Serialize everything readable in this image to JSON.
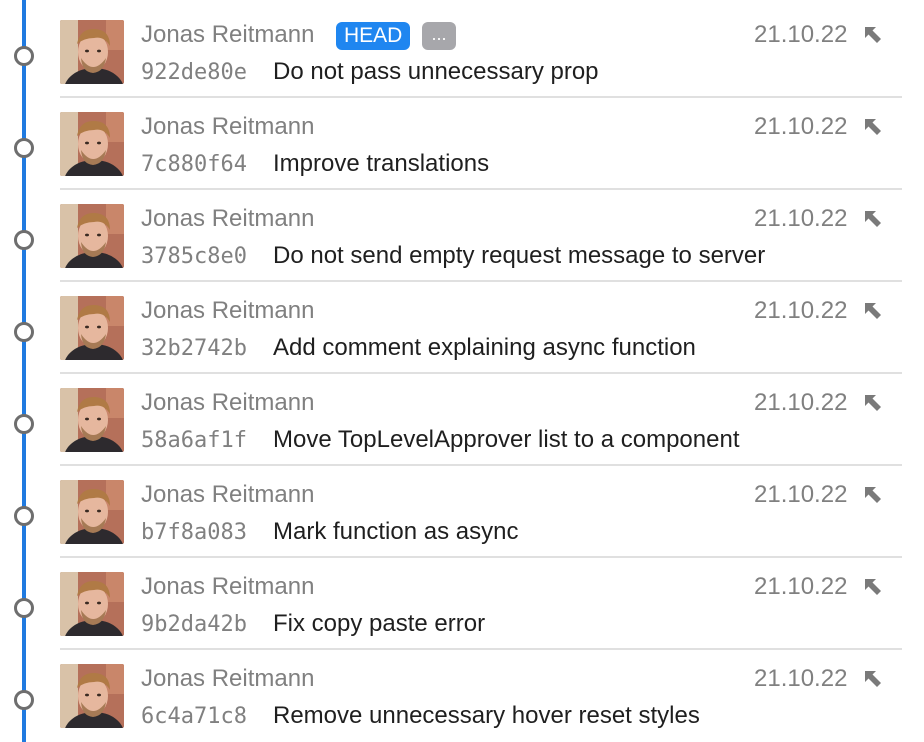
{
  "colors": {
    "timeline": "#1f7ae0",
    "head_badge": "#1f86f0",
    "more_badge": "#a7a7ab",
    "muted_text": "#808080",
    "message_text": "#1f1f1f"
  },
  "icons": {
    "jump": "arrow-up-left-icon",
    "node": "commit-node-icon",
    "avatar": "author-avatar"
  },
  "commits": [
    {
      "author": "Jonas Reitmann",
      "hash": "922de80e",
      "message": "Do not pass unnecessary prop",
      "date": "21.10.22",
      "tags": [
        "HEAD",
        "..."
      ]
    },
    {
      "author": "Jonas Reitmann",
      "hash": "7c880f64",
      "message": "Improve translations",
      "date": "21.10.22",
      "tags": []
    },
    {
      "author": "Jonas Reitmann",
      "hash": "3785c8e0",
      "message": "Do not send empty request message to server",
      "date": "21.10.22",
      "tags": []
    },
    {
      "author": "Jonas Reitmann",
      "hash": "32b2742b",
      "message": "Add comment explaining async function",
      "date": "21.10.22",
      "tags": []
    },
    {
      "author": "Jonas Reitmann",
      "hash": "58a6af1f",
      "message": "Move TopLevelApprover list to a component",
      "date": "21.10.22",
      "tags": []
    },
    {
      "author": "Jonas Reitmann",
      "hash": "b7f8a083",
      "message": "Mark function as async",
      "date": "21.10.22",
      "tags": []
    },
    {
      "author": "Jonas Reitmann",
      "hash": "9b2da42b",
      "message": "Fix copy paste error",
      "date": "21.10.22",
      "tags": []
    },
    {
      "author": "Jonas Reitmann",
      "hash": "6c4a71c8",
      "message": "Remove unnecessary hover reset styles",
      "date": "21.10.22",
      "tags": []
    }
  ]
}
